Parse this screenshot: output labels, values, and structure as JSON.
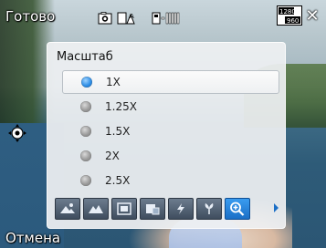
{
  "softkeys": {
    "left_top": "Готово",
    "left_bottom": "Отмена"
  },
  "status_icons": [
    {
      "name": "camera-mode-icon"
    },
    {
      "name": "white-balance-icon"
    },
    {
      "name": "storage-icon"
    },
    {
      "name": "resolution-icon",
      "label_top": "1280",
      "label_bottom": "960"
    }
  ],
  "panel": {
    "title": "Масштаб",
    "options": [
      {
        "label": "1X",
        "selected": true
      },
      {
        "label": "1.25X",
        "selected": false
      },
      {
        "label": "1.5X",
        "selected": false
      },
      {
        "label": "2X",
        "selected": false
      },
      {
        "label": "2.5X",
        "selected": false
      }
    ],
    "tools": [
      {
        "name": "exposure-icon",
        "active": false
      },
      {
        "name": "scene-icon",
        "active": false
      },
      {
        "name": "frame-icon",
        "active": false
      },
      {
        "name": "effects-icon",
        "active": false
      },
      {
        "name": "flash-icon",
        "active": false
      },
      {
        "name": "macro-icon",
        "active": false
      },
      {
        "name": "zoom-icon",
        "active": true
      }
    ]
  },
  "colors": {
    "accent": "#1b6fc6",
    "panel_bg": "#eef0f2"
  }
}
